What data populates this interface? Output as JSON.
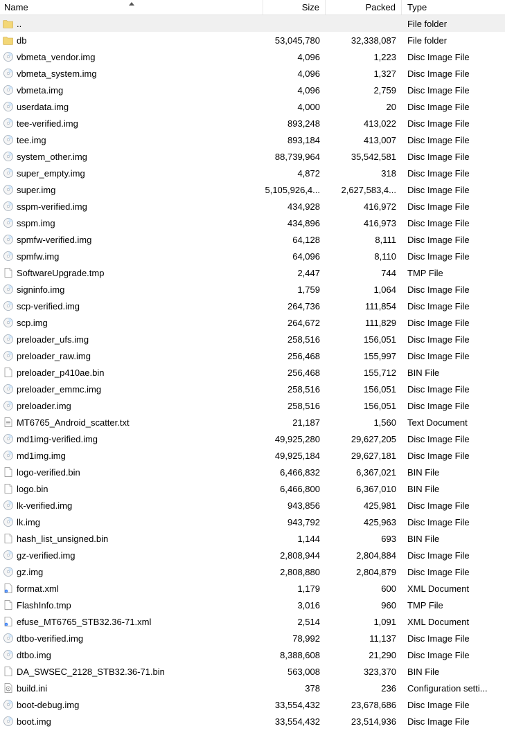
{
  "columns": {
    "name": "Name",
    "size": "Size",
    "packed": "Packed",
    "type": "Type"
  },
  "rows": [
    {
      "icon": "folder-up",
      "name": "..",
      "size": "",
      "packed": "",
      "type": "File folder",
      "selected": true
    },
    {
      "icon": "folder",
      "name": "db",
      "size": "53,045,780",
      "packed": "32,338,087",
      "type": "File folder"
    },
    {
      "icon": "disc",
      "name": "vbmeta_vendor.img",
      "size": "4,096",
      "packed": "1,223",
      "type": "Disc Image File"
    },
    {
      "icon": "disc",
      "name": "vbmeta_system.img",
      "size": "4,096",
      "packed": "1,327",
      "type": "Disc Image File"
    },
    {
      "icon": "disc",
      "name": "vbmeta.img",
      "size": "4,096",
      "packed": "2,759",
      "type": "Disc Image File"
    },
    {
      "icon": "disc",
      "name": "userdata.img",
      "size": "4,000",
      "packed": "20",
      "type": "Disc Image File"
    },
    {
      "icon": "disc",
      "name": "tee-verified.img",
      "size": "893,248",
      "packed": "413,022",
      "type": "Disc Image File"
    },
    {
      "icon": "disc",
      "name": "tee.img",
      "size": "893,184",
      "packed": "413,007",
      "type": "Disc Image File"
    },
    {
      "icon": "disc",
      "name": "system_other.img",
      "size": "88,739,964",
      "packed": "35,542,581",
      "type": "Disc Image File"
    },
    {
      "icon": "disc",
      "name": "super_empty.img",
      "size": "4,872",
      "packed": "318",
      "type": "Disc Image File"
    },
    {
      "icon": "disc",
      "name": "super.img",
      "size": "5,105,926,4...",
      "packed": "2,627,583,4...",
      "type": "Disc Image File"
    },
    {
      "icon": "disc",
      "name": "sspm-verified.img",
      "size": "434,928",
      "packed": "416,972",
      "type": "Disc Image File"
    },
    {
      "icon": "disc",
      "name": "sspm.img",
      "size": "434,896",
      "packed": "416,973",
      "type": "Disc Image File"
    },
    {
      "icon": "disc",
      "name": "spmfw-verified.img",
      "size": "64,128",
      "packed": "8,111",
      "type": "Disc Image File"
    },
    {
      "icon": "disc",
      "name": "spmfw.img",
      "size": "64,096",
      "packed": "8,110",
      "type": "Disc Image File"
    },
    {
      "icon": "file",
      "name": "SoftwareUpgrade.tmp",
      "size": "2,447",
      "packed": "744",
      "type": "TMP File"
    },
    {
      "icon": "disc",
      "name": "signinfo.img",
      "size": "1,759",
      "packed": "1,064",
      "type": "Disc Image File"
    },
    {
      "icon": "disc",
      "name": "scp-verified.img",
      "size": "264,736",
      "packed": "111,854",
      "type": "Disc Image File"
    },
    {
      "icon": "disc",
      "name": "scp.img",
      "size": "264,672",
      "packed": "111,829",
      "type": "Disc Image File"
    },
    {
      "icon": "disc",
      "name": "preloader_ufs.img",
      "size": "258,516",
      "packed": "156,051",
      "type": "Disc Image File"
    },
    {
      "icon": "disc",
      "name": "preloader_raw.img",
      "size": "256,468",
      "packed": "155,997",
      "type": "Disc Image File"
    },
    {
      "icon": "file",
      "name": "preloader_p410ae.bin",
      "size": "256,468",
      "packed": "155,712",
      "type": "BIN File"
    },
    {
      "icon": "disc",
      "name": "preloader_emmc.img",
      "size": "258,516",
      "packed": "156,051",
      "type": "Disc Image File"
    },
    {
      "icon": "disc",
      "name": "preloader.img",
      "size": "258,516",
      "packed": "156,051",
      "type": "Disc Image File"
    },
    {
      "icon": "text",
      "name": "MT6765_Android_scatter.txt",
      "size": "21,187",
      "packed": "1,560",
      "type": "Text Document"
    },
    {
      "icon": "disc",
      "name": "md1img-verified.img",
      "size": "49,925,280",
      "packed": "29,627,205",
      "type": "Disc Image File"
    },
    {
      "icon": "disc",
      "name": "md1img.img",
      "size": "49,925,184",
      "packed": "29,627,181",
      "type": "Disc Image File"
    },
    {
      "icon": "file",
      "name": "logo-verified.bin",
      "size": "6,466,832",
      "packed": "6,367,021",
      "type": "BIN File"
    },
    {
      "icon": "file",
      "name": "logo.bin",
      "size": "6,466,800",
      "packed": "6,367,010",
      "type": "BIN File"
    },
    {
      "icon": "disc",
      "name": "lk-verified.img",
      "size": "943,856",
      "packed": "425,981",
      "type": "Disc Image File"
    },
    {
      "icon": "disc",
      "name": "lk.img",
      "size": "943,792",
      "packed": "425,963",
      "type": "Disc Image File"
    },
    {
      "icon": "file",
      "name": "hash_list_unsigned.bin",
      "size": "1,144",
      "packed": "693",
      "type": "BIN File"
    },
    {
      "icon": "disc",
      "name": "gz-verified.img",
      "size": "2,808,944",
      "packed": "2,804,884",
      "type": "Disc Image File"
    },
    {
      "icon": "disc",
      "name": "gz.img",
      "size": "2,808,880",
      "packed": "2,804,879",
      "type": "Disc Image File"
    },
    {
      "icon": "xml",
      "name": "format.xml",
      "size": "1,179",
      "packed": "600",
      "type": "XML Document"
    },
    {
      "icon": "file",
      "name": "FlashInfo.tmp",
      "size": "3,016",
      "packed": "960",
      "type": "TMP File"
    },
    {
      "icon": "xml",
      "name": "efuse_MT6765_STB32.36-71.xml",
      "size": "2,514",
      "packed": "1,091",
      "type": "XML Document"
    },
    {
      "icon": "disc",
      "name": "dtbo-verified.img",
      "size": "78,992",
      "packed": "11,137",
      "type": "Disc Image File"
    },
    {
      "icon": "disc",
      "name": "dtbo.img",
      "size": "8,388,608",
      "packed": "21,290",
      "type": "Disc Image File"
    },
    {
      "icon": "file",
      "name": "DA_SWSEC_2128_STB32.36-71.bin",
      "size": "563,008",
      "packed": "323,370",
      "type": "BIN File"
    },
    {
      "icon": "ini",
      "name": "build.ini",
      "size": "378",
      "packed": "236",
      "type": "Configuration setti..."
    },
    {
      "icon": "disc",
      "name": "boot-debug.img",
      "size": "33,554,432",
      "packed": "23,678,686",
      "type": "Disc Image File"
    },
    {
      "icon": "disc",
      "name": "boot.img",
      "size": "33,554,432",
      "packed": "23,514,936",
      "type": "Disc Image File"
    }
  ]
}
